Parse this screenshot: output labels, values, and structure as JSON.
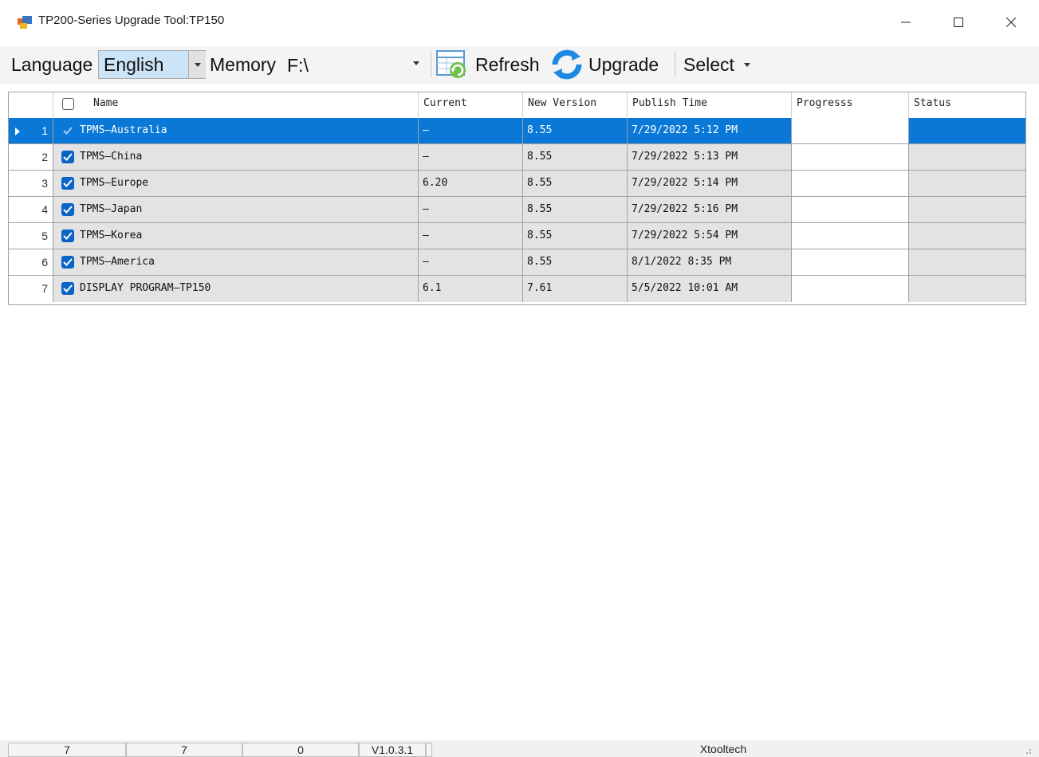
{
  "window": {
    "title": "TP200-Series Upgrade Tool:TP150",
    "icon": "app-icon",
    "controls": [
      "minimize-icon",
      "maximize-icon",
      "close-icon"
    ]
  },
  "toolbar": {
    "language_label": "Language",
    "language_value": "English",
    "memory_label": "Memory",
    "memory_value": "F:\\",
    "refresh_label": "Refresh",
    "upgrade_label": "Upgrade",
    "select_label": "Select"
  },
  "table": {
    "columns": [
      "Name",
      "Current",
      "New Version",
      "Publish Time",
      "Progresss",
      "Status"
    ],
    "rows": [
      {
        "index": "1",
        "checked": true,
        "name": "TPMS—Australia",
        "current": "—",
        "new_version": "8.55",
        "publish_time": "7/29/2022 5:12 PM",
        "progress": "",
        "status": "",
        "selected": true
      },
      {
        "index": "2",
        "checked": true,
        "name": "TPMS—China",
        "current": "—",
        "new_version": "8.55",
        "publish_time": "7/29/2022 5:13 PM",
        "progress": "",
        "status": ""
      },
      {
        "index": "3",
        "checked": true,
        "name": "TPMS—Europe",
        "current": "6.20",
        "new_version": "8.55",
        "publish_time": "7/29/2022 5:14 PM",
        "progress": "",
        "status": ""
      },
      {
        "index": "4",
        "checked": true,
        "name": "TPMS—Japan",
        "current": "—",
        "new_version": "8.55",
        "publish_time": "7/29/2022 5:16 PM",
        "progress": "",
        "status": ""
      },
      {
        "index": "5",
        "checked": true,
        "name": "TPMS—Korea",
        "current": "—",
        "new_version": "8.55",
        "publish_time": "7/29/2022 5:54 PM",
        "progress": "",
        "status": ""
      },
      {
        "index": "6",
        "checked": true,
        "name": "TPMS—America",
        "current": "—",
        "new_version": "8.55",
        "publish_time": "8/1/2022 8:35 PM",
        "progress": "",
        "status": ""
      },
      {
        "index": "7",
        "checked": true,
        "name": "DISPLAY PROGRAM—TP150",
        "current": "6.1",
        "new_version": "7.61",
        "publish_time": "5/5/2022 10:01 AM",
        "progress": "",
        "status": ""
      }
    ]
  },
  "statusbar": {
    "cells": [
      "7",
      "7",
      "0",
      "V1.0.3.1",
      "",
      "Xtooltech"
    ]
  },
  "colors": {
    "selection": "#0a78d7",
    "checkbox": "#0a64c8",
    "row_background": "#e3e3e3"
  }
}
